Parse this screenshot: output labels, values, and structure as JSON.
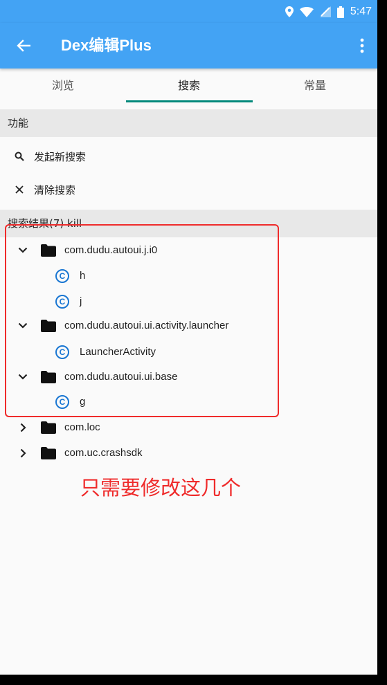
{
  "status_bar": {
    "time": "5:47",
    "icons": [
      "location-icon",
      "wifi-icon",
      "signal-icon",
      "battery-icon"
    ]
  },
  "app_bar": {
    "title": "Dex编辑Plus",
    "back_icon": "arrow-left-icon",
    "more_icon": "more-vert-icon"
  },
  "tabs": [
    {
      "label": "浏览",
      "active": false
    },
    {
      "label": "搜索",
      "active": true
    },
    {
      "label": "常量",
      "active": false
    }
  ],
  "functions_section": {
    "header": "功能",
    "actions": [
      {
        "label": "发起新搜索",
        "icon": "search-icon"
      },
      {
        "label": "清除搜索",
        "icon": "close-icon"
      }
    ]
  },
  "results_section": {
    "header": "搜索结果(7) kill"
  },
  "tree": [
    {
      "type": "package",
      "label": "com.dudu.autoui.j.i0",
      "expanded": true
    },
    {
      "type": "class",
      "label": "h"
    },
    {
      "type": "class",
      "label": "j"
    },
    {
      "type": "package",
      "label": "com.dudu.autoui.ui.activity.launcher",
      "expanded": true
    },
    {
      "type": "class",
      "label": "LauncherActivity"
    },
    {
      "type": "package",
      "label": "com.dudu.autoui.ui.base",
      "expanded": true
    },
    {
      "type": "class",
      "label": "g"
    },
    {
      "type": "package",
      "label": "com.loc",
      "expanded": false
    },
    {
      "type": "package",
      "label": "com.uc.crashsdk",
      "expanded": false
    }
  ],
  "class_icon_letter": "C",
  "annotation_text": "只需要修改这几个",
  "colors": {
    "app_bar": "#43a3f4",
    "tab_indicator": "#00897b",
    "class_icon": "#1976d2",
    "annotation_red": "#ef2b2b",
    "section_bg": "#e8e8e8"
  }
}
